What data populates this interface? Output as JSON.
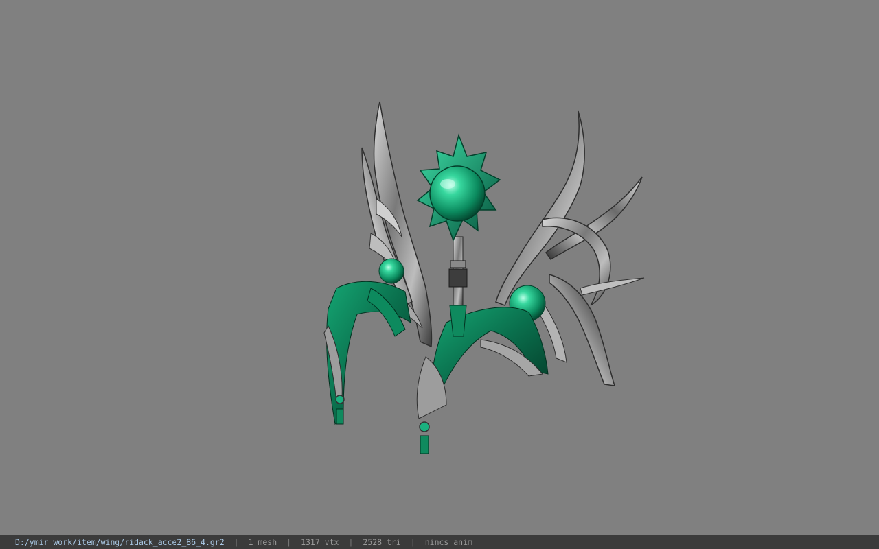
{
  "viewer": {
    "background_color": "#808080",
    "model_name": "ridack_acce2_86_4",
    "colors": {
      "gem_green": "#1db784",
      "ribbon_green": "#0c7a56",
      "metal": "#9a9a9a",
      "metal_dark": "#3a3a3a"
    }
  },
  "status_bar": {
    "file_path": "D:/ymir work/item/wing/ridack_acce2_86_4.gr2",
    "separator": "|",
    "mesh_count": "1 mesh",
    "vertex_count": "1317 vtx",
    "triangle_count": "2528 tri",
    "anim_status": "nincs anim"
  }
}
